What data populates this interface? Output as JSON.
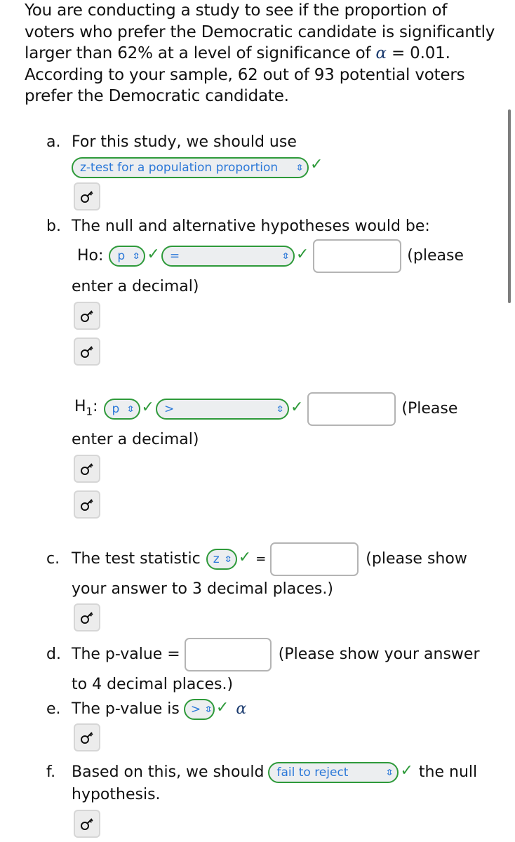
{
  "intro": {
    "part1": "You are conducting a study to see if the proportion of voters who prefer the Democratic candidate is significantly larger than 62% at a level of significance of ",
    "alpha_symbol": "α",
    "part2": " = 0.01. According to your sample, 62 out of 93 potential voters prefer the Democratic candidate."
  },
  "colors": {
    "correct_green": "#2e9a3a",
    "select_text_blue": "#2b78d8",
    "select_bg": "#eceef0",
    "input_border": "#b4b4b4"
  },
  "icons": {
    "chevron": "⇕",
    "check": "✓",
    "key": "key-icon"
  },
  "a": {
    "marker": "a.",
    "text": "For this study, we should use",
    "select_value": "z-test for a population proportion",
    "status": "correct"
  },
  "b": {
    "marker": "b.",
    "text": "The null and alternative hypotheses would be:",
    "h0": {
      "label": "Ho:",
      "param_value": "p",
      "operator_value": "=",
      "input_value": "",
      "hint_start": "(please",
      "hint_end": "enter a decimal)"
    },
    "h1": {
      "label_main": "H",
      "label_sub": "1",
      "label_colon": ":",
      "param_value": "p",
      "operator_value": ">",
      "input_value": "",
      "hint_start": "(Please",
      "hint_end": "enter a decimal)"
    }
  },
  "c": {
    "marker": "c.",
    "text": "The test statistic",
    "select_value": "z",
    "equals": "=",
    "input_value": "",
    "hint_start": "(please show",
    "hint_end": "your answer to 3 decimal places.)"
  },
  "d": {
    "marker": "d.",
    "text": "The p-value =",
    "input_value": "",
    "hint_start": "(Please show your answer",
    "hint_end": "to 4 decimal places.)"
  },
  "e": {
    "marker": "e.",
    "text": "The p-value is",
    "select_value": ">",
    "alpha_symbol": "α"
  },
  "f": {
    "marker": "f.",
    "text": "Based on this, we should",
    "select_value": "fail to reject",
    "text_after": "the null",
    "text_end": "hypothesis."
  }
}
